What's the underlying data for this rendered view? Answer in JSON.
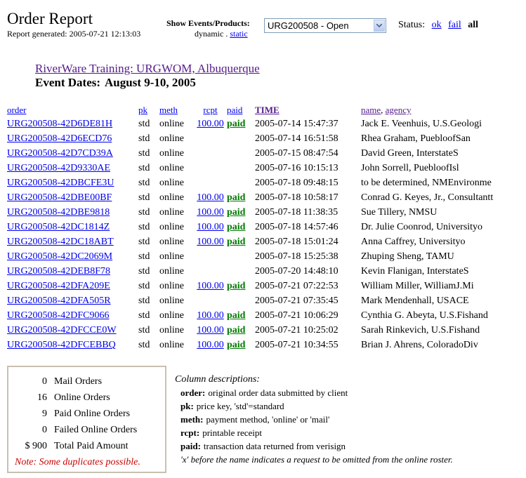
{
  "header": {
    "title": "Order Report",
    "generated": "Report generated: 2005-07-21 12:13:03",
    "show_label": "Show Events/Products:",
    "view_dynamic": "dynamic",
    "view_sep": ".",
    "view_static": "static",
    "selected_event": "URG200508 - Open",
    "status_label": "Status:",
    "status_ok": "ok",
    "status_fail": "fail",
    "status_all": "all"
  },
  "event": {
    "title": "RiverWare Training: URGWOM, Albuquerque",
    "dates_label": "Event Dates:",
    "dates": "August 9-10, 2005"
  },
  "table": {
    "columns": {
      "order": "order",
      "pk": "pk",
      "meth": "meth",
      "rcpt": "rcpt",
      "paid": "paid",
      "time": "TIME",
      "name": "name",
      "comma": ",",
      "agency": "agency"
    },
    "rows": [
      {
        "order": "URG200508-42D6DE81H",
        "pk": "std",
        "meth": "online",
        "rcpt": "100.00",
        "paid": "paid",
        "time": "2005-07-14 15:47:37",
        "name": "Jack E. Veenhuis, U.S.Geologi"
      },
      {
        "order": "URG200508-42D6ECD76",
        "pk": "std",
        "meth": "online",
        "rcpt": "",
        "paid": "",
        "time": "2005-07-14 16:51:58",
        "name": "Rhea Graham, PuebloofSan"
      },
      {
        "order": "URG200508-42D7CD39A",
        "pk": "std",
        "meth": "online",
        "rcpt": "",
        "paid": "",
        "time": "2005-07-15 08:47:54",
        "name": "David Green, InterstateS"
      },
      {
        "order": "URG200508-42D9330AE",
        "pk": "std",
        "meth": "online",
        "rcpt": "",
        "paid": "",
        "time": "2005-07-16 10:15:13",
        "name": "John Sorrell, PuebloofIsl"
      },
      {
        "order": "URG200508-42DBCFE3U",
        "pk": "std",
        "meth": "online",
        "rcpt": "",
        "paid": "",
        "time": "2005-07-18 09:48:15",
        "name": "to be determined, NMEnvironme"
      },
      {
        "order": "URG200508-42DBE00BF",
        "pk": "std",
        "meth": "online",
        "rcpt": "100.00",
        "paid": "paid",
        "time": "2005-07-18 10:58:17",
        "name": "Conrad G. Keyes, Jr., Consultantt"
      },
      {
        "order": "URG200508-42DBE9818",
        "pk": "std",
        "meth": "online",
        "rcpt": "100.00",
        "paid": "paid",
        "time": "2005-07-18 11:38:35",
        "name": "Sue Tillery, NMSU"
      },
      {
        "order": "URG200508-42DC1814Z",
        "pk": "std",
        "meth": "online",
        "rcpt": "100.00",
        "paid": "paid",
        "time": "2005-07-18 14:57:46",
        "name": "Dr. Julie Coonrod, Universityo"
      },
      {
        "order": "URG200508-42DC18ABT",
        "pk": "std",
        "meth": "online",
        "rcpt": "100.00",
        "paid": "paid",
        "time": "2005-07-18 15:01:24",
        "name": "Anna Caffrey, Universityo"
      },
      {
        "order": "URG200508-42DC2069M",
        "pk": "std",
        "meth": "online",
        "rcpt": "",
        "paid": "",
        "time": "2005-07-18 15:25:38",
        "name": "Zhuping Sheng, TAMU"
      },
      {
        "order": "URG200508-42DEB8F78",
        "pk": "std",
        "meth": "online",
        "rcpt": "",
        "paid": "",
        "time": "2005-07-20 14:48:10",
        "name": "Kevin Flanigan, InterstateS"
      },
      {
        "order": "URG200508-42DFA209E",
        "pk": "std",
        "meth": "online",
        "rcpt": "100.00",
        "paid": "paid",
        "time": "2005-07-21 07:22:53",
        "name": "William Miller, WilliamJ.Mi"
      },
      {
        "order": "URG200508-42DFA505R",
        "pk": "std",
        "meth": "online",
        "rcpt": "",
        "paid": "",
        "time": "2005-07-21 07:35:45",
        "name": "Mark Mendenhall, USACE"
      },
      {
        "order": "URG200508-42DFC9066",
        "pk": "std",
        "meth": "online",
        "rcpt": "100.00",
        "paid": "paid",
        "time": "2005-07-21 10:06:29",
        "name": "Cynthia G. Abeyta, U.S.Fishand"
      },
      {
        "order": "URG200508-42DFCCE0W",
        "pk": "std",
        "meth": "online",
        "rcpt": "100.00",
        "paid": "paid",
        "time": "2005-07-21 10:25:02",
        "name": "Sarah Rinkevich, U.S.Fishand"
      },
      {
        "order": "URG200508-42DFCEBBQ",
        "pk": "std",
        "meth": "online",
        "rcpt": "100.00",
        "paid": "paid",
        "time": "2005-07-21 10:34:55",
        "name": "Brian J. Ahrens, ColoradoDiv"
      }
    ]
  },
  "summary": {
    "items": [
      {
        "n": "0",
        "label": "Mail Orders"
      },
      {
        "n": "16",
        "label": "Online Orders"
      },
      {
        "n": "9",
        "label": "Paid Online Orders"
      },
      {
        "n": "0",
        "label": "Failed Online Orders"
      },
      {
        "n": "$ 900",
        "label": "Total Paid Amount"
      }
    ],
    "note": "Note: Some duplicates possible."
  },
  "descriptions": {
    "heading": "Column descriptions:",
    "items": [
      {
        "key": "order:",
        "text": "original order data submitted by client"
      },
      {
        "key": "pk:",
        "text": "price key, 'std'=standard"
      },
      {
        "key": "meth:",
        "text": "payment method, 'online' or 'mail'"
      },
      {
        "key": "rcpt:",
        "text": "printable receipt"
      },
      {
        "key": "paid:",
        "text": "transaction data returned from verisign"
      }
    ],
    "note": "'x' before the name indicates a request to be omitted from the online roster."
  },
  "colors": {
    "link": "#0000ee",
    "visited": "#551a8b",
    "paid": "#007a00",
    "note": "#cc0000"
  }
}
